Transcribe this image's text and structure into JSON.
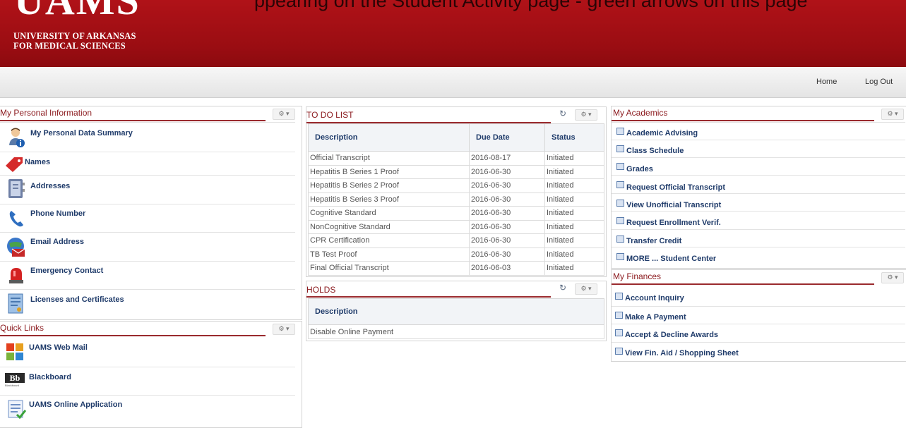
{
  "header": {
    "logo_text": "UAMS",
    "logo_line1": "UNIVERSITY OF ARKANSAS",
    "logo_line2": "FOR MEDICAL SCIENCES",
    "caption": "ppearing on the Student Activity page - green arrows on this page"
  },
  "nav": {
    "home": "Home",
    "logout": "Log Out"
  },
  "personal": {
    "title": "My Personal Information",
    "items": [
      {
        "label": "My Personal Data Summary",
        "icon": "person-info-icon"
      },
      {
        "label": "Names",
        "icon": "tag-icon"
      },
      {
        "label": "Addresses",
        "icon": "address-book-icon"
      },
      {
        "label": "Phone Number",
        "icon": "phone-icon"
      },
      {
        "label": "Email Address",
        "icon": "globe-mail-icon"
      },
      {
        "label": "Emergency Contact",
        "icon": "siren-icon"
      },
      {
        "label": "Licenses and Certificates",
        "icon": "certificate-icon"
      }
    ]
  },
  "quicklinks": {
    "title": "Quick Links",
    "items": [
      {
        "label": "UAMS Web Mail",
        "icon": "office-icon"
      },
      {
        "label": "Blackboard",
        "icon": "blackboard-icon",
        "icon_text": "Bb",
        "icon_sub": "Blackboard"
      },
      {
        "label": "UAMS Online Application",
        "icon": "application-form-icon"
      }
    ]
  },
  "todo": {
    "title": "TO DO LIST",
    "columns": [
      "Description",
      "Due Date",
      "Status"
    ],
    "rows": [
      [
        "Official Transcript",
        "2016-08-17",
        "Initiated"
      ],
      [
        "Hepatitis B Series 1 Proof",
        "2016-06-30",
        "Initiated"
      ],
      [
        "Hepatitis B Series 2 Proof",
        "2016-06-30",
        "Initiated"
      ],
      [
        "Hepatitis B Series 3 Proof",
        "2016-06-30",
        "Initiated"
      ],
      [
        "Cognitive Standard",
        "2016-06-30",
        "Initiated"
      ],
      [
        "NonCognitive Standard",
        "2016-06-30",
        "Initiated"
      ],
      [
        "CPR Certification",
        "2016-06-30",
        "Initiated"
      ],
      [
        "TB Test Proof",
        "2016-06-30",
        "Initiated"
      ],
      [
        "Final Official Transcript",
        "2016-06-03",
        "Initiated"
      ]
    ]
  },
  "holds": {
    "title": "HOLDS",
    "columns": [
      "Description"
    ],
    "rows": [
      [
        "Disable Online Payment"
      ]
    ]
  },
  "academics": {
    "title": "My Academics",
    "items": [
      "Academic Advising",
      "Class Schedule",
      "Grades",
      "Request Official Transcript",
      "View Unofficial Transcript",
      "Request Enrollment Verif.",
      "Transfer Credit",
      "MORE ... Student Center"
    ]
  },
  "finances": {
    "title": "My Finances",
    "items": [
      "Account Inquiry",
      "Make A Payment",
      "Accept & Decline Awards",
      "View Fin. Aid / Shopping Sheet"
    ]
  },
  "icons": {
    "gear": "⚙ ▾",
    "refresh": "↻"
  },
  "colors": {
    "header_red": "#a30f15",
    "title_red": "#8b1a1e",
    "link_blue": "#1f3b6a"
  }
}
